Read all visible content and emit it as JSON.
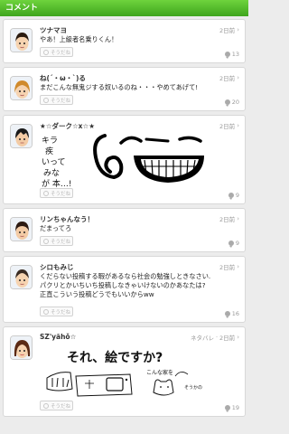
{
  "header": {
    "title": "コメント"
  },
  "posts": [
    {
      "username": "ツナマヨ",
      "time": "2日前",
      "lines": [
        "やあ！上級者名乗りくん！"
      ],
      "yeah": "そうだね",
      "comments": "13",
      "avatar_colors": {
        "hair": "#2a1a10",
        "skin": "#f6d3b0"
      }
    },
    {
      "username": "ね(´・ω・`)る",
      "time": "2日前",
      "lines": [
        "まだこんな無鬼ジする奴いるのね・・・やめてあげて!"
      ],
      "yeah": "そうだね",
      "comments": "20",
      "avatar_colors": {
        "hair": "#d08a2c",
        "skin": "#f6d3b0"
      }
    },
    {
      "username": "★☆ダーク☆x☆★",
      "time": "2日前",
      "lines": [],
      "drawing_text": [
        "キラ",
        "疾",
        "いって",
        "みな",
        "が 本…!"
      ],
      "yeah": "そうだね",
      "comments": "9",
      "avatar_colors": {
        "hair": "#1a1a1a",
        "skin": "#f3cba5"
      }
    },
    {
      "username": "リンちゃんなう！",
      "time": "2日前",
      "lines": [
        "だまってろ"
      ],
      "yeah": "そうだね",
      "comments": "9",
      "avatar_colors": {
        "hair": "#2c1a12",
        "skin": "#f3cba5"
      }
    },
    {
      "username": "シロもみじ",
      "time": "2日前",
      "lines": [
        "くだらない投稿する暇があるなら社会の勉強しときなさい.",
        "パクリとかいちいち投稿しなきゃいけないのかあなたは?",
        "正直こういう投稿どうでもいいからww"
      ],
      "yeah": "そうだね",
      "comments": "16",
      "avatar_colors": {
        "hair": "#3a2b22",
        "skin": "#f6d3b0"
      }
    },
    {
      "username": "SZ'yãhǒ☆",
      "time": "2日前",
      "spoiler": "ネタバレ",
      "lines": [],
      "drawing_text": [
        "それ、絵ですか?",
        "こんな家を",
        "そうかの"
      ],
      "yeah": "そうだね",
      "comments": "19",
      "avatar_colors": {
        "hair": "#5a2a14",
        "skin": "#f6d3b0"
      }
    }
  ]
}
